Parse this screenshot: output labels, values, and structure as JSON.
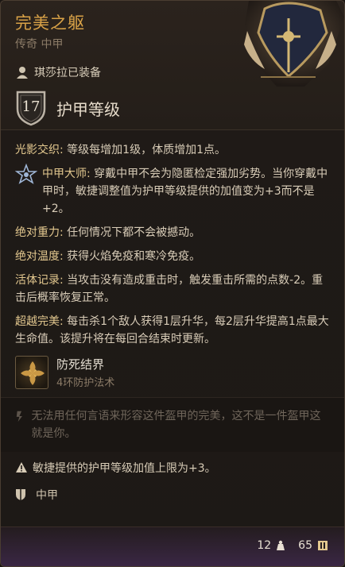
{
  "item": {
    "name": "完美之躯",
    "rarity_type": "传奇 中甲",
    "equipped_by": "琪莎拉已装备",
    "armor_class": "17",
    "armor_class_label": "护甲等级"
  },
  "effects": [
    {
      "name": "光影交织:",
      "text": " 等级每增加1级，体质增加1点。"
    },
    {
      "name": "中甲大师:",
      "text": " 穿戴中甲不会为隐匿检定强加劣势。当你穿戴中甲时，敏捷调整值为护甲等级提供的加值变为+3而不是+2。",
      "icon": "medium-armor-master-icon"
    },
    {
      "name": "绝对重力:",
      "text": " 任何情况下都不会被撼动。"
    },
    {
      "name": "绝对温度:",
      "text": " 获得火焰免疫和寒冷免疫。"
    },
    {
      "name": "活体记录:",
      "text": " 当攻击没有造成重击时，触发重击所需的点数-2。重击后概率恢复正常。"
    },
    {
      "name": "超越完美:",
      "text": " 每击杀1个敌人获得1层升华，每2层升华提高1点最大生命值。该提升将在每回合结束时更新。"
    }
  ],
  "spell": {
    "name": "防死结界",
    "level": "4环防护法术"
  },
  "flavor_text": "无法用任何言语来形容这件盔甲的完美，这不是一件盔甲这就是你。",
  "warning": "敏捷提供的护甲等级加值上限为+3。",
  "armor_type": "中甲",
  "footer": {
    "weight": "12",
    "price": "65"
  },
  "colors": {
    "title": "#d9a247",
    "effect_name": "#e3c88f",
    "footer_purple": "#3a2744"
  }
}
